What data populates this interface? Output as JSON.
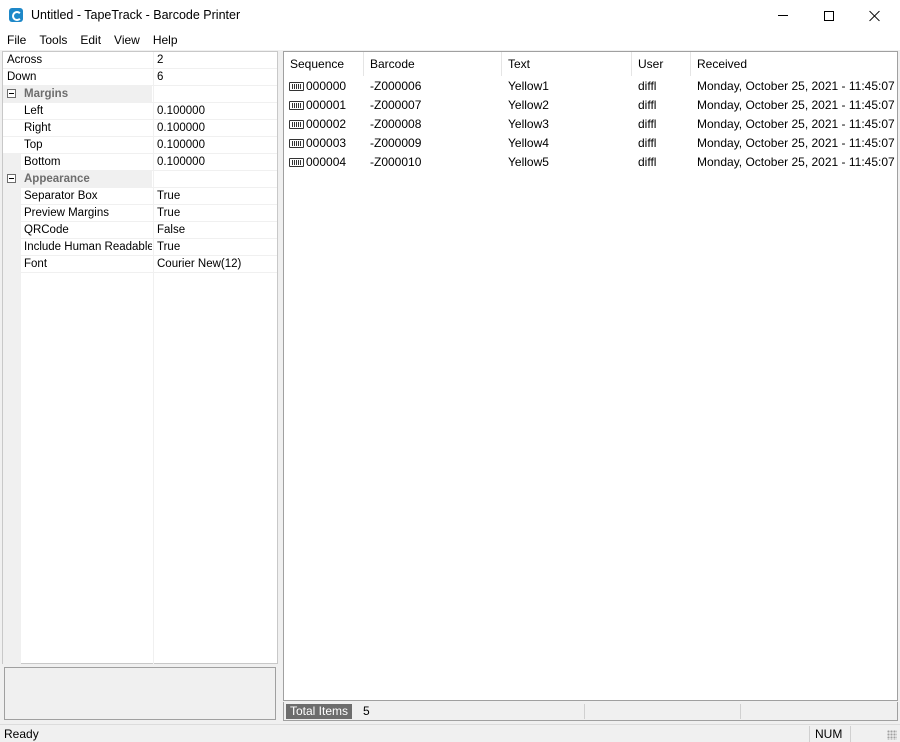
{
  "window": {
    "title": "Untitled - TapeTrack - Barcode Printer"
  },
  "menu": [
    "File",
    "Tools",
    "Edit",
    "View",
    "Help"
  ],
  "properties": {
    "rows": [
      {
        "name": "Across",
        "value": "2",
        "kind": "top"
      },
      {
        "name": "Down",
        "value": "6",
        "kind": "top"
      },
      {
        "name": "Margins",
        "value": "",
        "kind": "category"
      },
      {
        "name": "Left",
        "value": "0.100000",
        "kind": "child"
      },
      {
        "name": "Right",
        "value": "0.100000",
        "kind": "child"
      },
      {
        "name": "Top",
        "value": "0.100000",
        "kind": "child"
      },
      {
        "name": "Bottom",
        "value": "0.100000",
        "kind": "child"
      },
      {
        "name": "Appearance",
        "value": "",
        "kind": "category"
      },
      {
        "name": "Separator Box",
        "value": "True",
        "kind": "child"
      },
      {
        "name": "Preview Margins",
        "value": "True",
        "kind": "child"
      },
      {
        "name": "QRCode",
        "value": "False",
        "kind": "child"
      },
      {
        "name": "Include Human Readable",
        "value": "True",
        "kind": "child"
      },
      {
        "name": "Font",
        "value": "Courier New(12)",
        "kind": "child"
      }
    ]
  },
  "list": {
    "columns": [
      "Sequence",
      "Barcode",
      "Text",
      "User",
      "Received"
    ],
    "rows": [
      {
        "sequence": "000000",
        "barcode": "-Z000006",
        "text": "Yellow1",
        "user": "diffl",
        "received": "Monday, October 25, 2021 - 11:45:07"
      },
      {
        "sequence": "000001",
        "barcode": "-Z000007",
        "text": "Yellow2",
        "user": "diffl",
        "received": "Monday, October 25, 2021 - 11:45:07"
      },
      {
        "sequence": "000002",
        "barcode": "-Z000008",
        "text": "Yellow3",
        "user": "diffl",
        "received": "Monday, October 25, 2021 - 11:45:07"
      },
      {
        "sequence": "000003",
        "barcode": "-Z000009",
        "text": "Yellow4",
        "user": "diffl",
        "received": "Monday, October 25, 2021 - 11:45:07"
      },
      {
        "sequence": "000004",
        "barcode": "-Z000010",
        "text": "Yellow5",
        "user": "diffl",
        "received": "Monday, October 25, 2021 - 11:45:07"
      }
    ],
    "row_icon": "barcode-icon",
    "total_label": "Total Items",
    "total_count": "5"
  },
  "status": {
    "text": "Ready",
    "num": "NUM"
  }
}
